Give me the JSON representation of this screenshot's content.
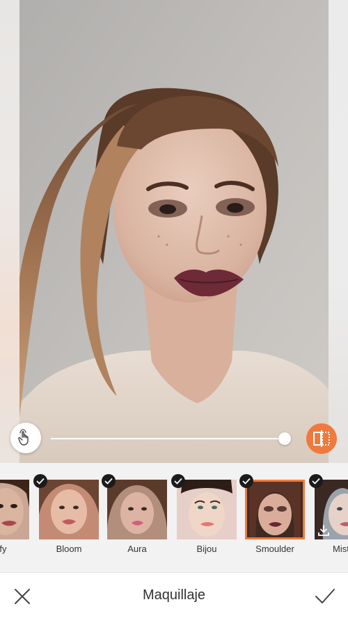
{
  "editor": {
    "feature_title": "Maquillaje",
    "intensity_percent": 100,
    "accent_color": "#ef7a3d"
  },
  "effects": [
    {
      "label": "trify",
      "selected": false
    },
    {
      "label": "Bloom",
      "selected": false
    },
    {
      "label": "Aura",
      "selected": false
    },
    {
      "label": "Bijou",
      "selected": false
    },
    {
      "label": "Smoulder",
      "selected": true
    },
    {
      "label": "Mistle",
      "selected": false
    }
  ],
  "icons": {
    "touch": "hand-touch-icon",
    "compare": "split-compare-icon",
    "cancel": "close-icon",
    "confirm": "checkmark-icon",
    "badge": "check-badge-icon",
    "download": "download-icon"
  }
}
